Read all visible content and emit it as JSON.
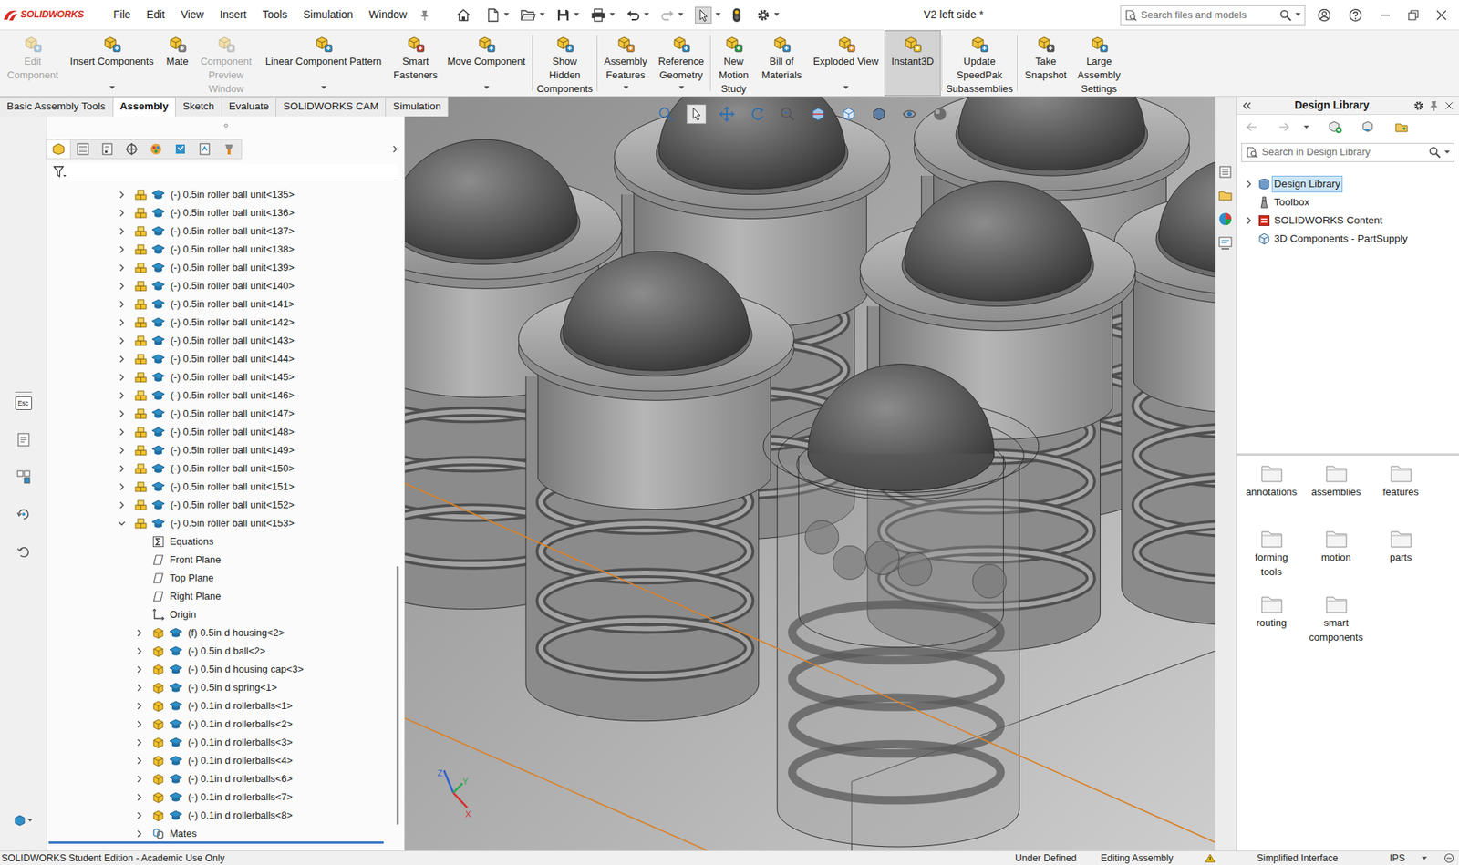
{
  "window": {
    "app_name": "SOLIDWORKS",
    "title": "V2 left side *"
  },
  "menu": [
    "File",
    "Edit",
    "View",
    "Insert",
    "Tools",
    "Simulation",
    "Window"
  ],
  "search": {
    "placeholder": "Search files and models"
  },
  "commands": [
    {
      "label": "Edit Component",
      "disabled": true,
      "selected": false,
      "dropdown": false
    },
    {
      "label": "Insert Components",
      "disabled": false,
      "selected": false,
      "dropdown": true
    },
    {
      "label": "Mate",
      "disabled": false,
      "selected": false,
      "dropdown": false
    },
    {
      "label": "Component Preview Window",
      "disabled": true,
      "selected": false,
      "dropdown": false
    },
    {
      "label": "Linear Component Pattern",
      "disabled": false,
      "selected": false,
      "dropdown": true
    },
    {
      "label": "Smart Fasteners",
      "disabled": false,
      "selected": false,
      "dropdown": false
    },
    {
      "label": "Move Component",
      "disabled": false,
      "selected": false,
      "dropdown": true
    },
    {
      "label": "Show Hidden Components",
      "disabled": false,
      "selected": false,
      "dropdown": false
    },
    {
      "label": "Assembly Features",
      "disabled": false,
      "selected": false,
      "dropdown": true
    },
    {
      "label": "Reference Geometry",
      "disabled": false,
      "selected": false,
      "dropdown": true
    },
    {
      "label": "New Motion Study",
      "disabled": false,
      "selected": false,
      "dropdown": false
    },
    {
      "label": "Bill of Materials",
      "disabled": false,
      "selected": false,
      "dropdown": false
    },
    {
      "label": "Exploded View",
      "disabled": false,
      "selected": false,
      "dropdown": true
    },
    {
      "label": "Instant3D",
      "disabled": false,
      "selected": true,
      "dropdown": false
    },
    {
      "label": "Update SpeedPak Subassemblies",
      "disabled": false,
      "selected": false,
      "dropdown": false
    },
    {
      "label": "Take Snapshot",
      "disabled": false,
      "selected": false,
      "dropdown": false
    },
    {
      "label": "Large Assembly Settings",
      "disabled": false,
      "selected": false,
      "dropdown": false
    }
  ],
  "tabs": [
    {
      "label": "Basic Assembly Tools",
      "selected": false
    },
    {
      "label": "Assembly",
      "selected": true
    },
    {
      "label": "Sketch",
      "selected": false
    },
    {
      "label": "Evaluate",
      "selected": false
    },
    {
      "label": "SOLIDWORKS CAM",
      "selected": false
    },
    {
      "label": "Simulation",
      "selected": false
    }
  ],
  "left_strip": {
    "esc_label": "Esc"
  },
  "viewport": {
    "triad": {
      "x": "X",
      "y": "Y",
      "z": "Z"
    }
  },
  "tree": {
    "rows": [
      {
        "label": "(-) 0.5in roller ball unit<135>",
        "kind": "assembly",
        "depth": 0,
        "expandable": true,
        "expanded": false
      },
      {
        "label": "(-) 0.5in roller ball unit<136>",
        "kind": "assembly",
        "depth": 0,
        "expandable": true,
        "expanded": false
      },
      {
        "label": "(-) 0.5in roller ball unit<137>",
        "kind": "assembly",
        "depth": 0,
        "expandable": true,
        "expanded": false
      },
      {
        "label": "(-) 0.5in roller ball unit<138>",
        "kind": "assembly",
        "depth": 0,
        "expandable": true,
        "expanded": false
      },
      {
        "label": "(-) 0.5in roller ball unit<139>",
        "kind": "assembly",
        "depth": 0,
        "expandable": true,
        "expanded": false
      },
      {
        "label": "(-) 0.5in roller ball unit<140>",
        "kind": "assembly",
        "depth": 0,
        "expandable": true,
        "expanded": false
      },
      {
        "label": "(-) 0.5in roller ball unit<141>",
        "kind": "assembly",
        "depth": 0,
        "expandable": true,
        "expanded": false
      },
      {
        "label": "(-) 0.5in roller ball unit<142>",
        "kind": "assembly",
        "depth": 0,
        "expandable": true,
        "expanded": false
      },
      {
        "label": "(-) 0.5in roller ball unit<143>",
        "kind": "assembly",
        "depth": 0,
        "expandable": true,
        "expanded": false
      },
      {
        "label": "(-) 0.5in roller ball unit<144>",
        "kind": "assembly",
        "depth": 0,
        "expandable": true,
        "expanded": false
      },
      {
        "label": "(-) 0.5in roller ball unit<145>",
        "kind": "assembly",
        "depth": 0,
        "expandable": true,
        "expanded": false
      },
      {
        "label": "(-) 0.5in roller ball unit<146>",
        "kind": "assembly",
        "depth": 0,
        "expandable": true,
        "expanded": false
      },
      {
        "label": "(-) 0.5in roller ball unit<147>",
        "kind": "assembly",
        "depth": 0,
        "expandable": true,
        "expanded": false
      },
      {
        "label": "(-) 0.5in roller ball unit<148>",
        "kind": "assembly",
        "depth": 0,
        "expandable": true,
        "expanded": false
      },
      {
        "label": "(-) 0.5in roller ball unit<149>",
        "kind": "assembly",
        "depth": 0,
        "expandable": true,
        "expanded": false
      },
      {
        "label": "(-) 0.5in roller ball unit<150>",
        "kind": "assembly",
        "depth": 0,
        "expandable": true,
        "expanded": false
      },
      {
        "label": "(-) 0.5in roller ball unit<151>",
        "kind": "assembly",
        "depth": 0,
        "expandable": true,
        "expanded": false
      },
      {
        "label": "(-) 0.5in roller ball unit<152>",
        "kind": "assembly",
        "depth": 0,
        "expandable": true,
        "expanded": false
      },
      {
        "label": "(-) 0.5in roller ball unit<153>",
        "kind": "assembly",
        "depth": 0,
        "expandable": true,
        "expanded": true
      },
      {
        "label": "Equations",
        "kind": "equations",
        "depth": 1,
        "expandable": false,
        "expanded": false
      },
      {
        "label": "Front Plane",
        "kind": "plane",
        "depth": 1,
        "expandable": false,
        "expanded": false
      },
      {
        "label": "Top Plane",
        "kind": "plane",
        "depth": 1,
        "expandable": false,
        "expanded": false
      },
      {
        "label": "Right Plane",
        "kind": "plane",
        "depth": 1,
        "expandable": false,
        "expanded": false
      },
      {
        "label": "Origin",
        "kind": "origin",
        "depth": 1,
        "expandable": false,
        "expanded": false
      },
      {
        "label": "(f) 0.5in d housing<2>",
        "kind": "part",
        "depth": 1,
        "expandable": true,
        "expanded": false
      },
      {
        "label": "(-) 0.5in d ball<2>",
        "kind": "part",
        "depth": 1,
        "expandable": true,
        "expanded": false
      },
      {
        "label": "(-) 0.5in d housing cap<3>",
        "kind": "part",
        "depth": 1,
        "expandable": true,
        "expanded": false
      },
      {
        "label": "(-) 0.5in d spring<1>",
        "kind": "part",
        "depth": 1,
        "expandable": true,
        "expanded": false
      },
      {
        "label": "(-) 0.1in d rollerballs<1>",
        "kind": "part",
        "depth": 1,
        "expandable": true,
        "expanded": false
      },
      {
        "label": "(-) 0.1in d rollerballs<2>",
        "kind": "part",
        "depth": 1,
        "expandable": true,
        "expanded": false
      },
      {
        "label": "(-) 0.1in d rollerballs<3>",
        "kind": "part",
        "depth": 1,
        "expandable": true,
        "expanded": false
      },
      {
        "label": "(-) 0.1in d rollerballs<4>",
        "kind": "part",
        "depth": 1,
        "expandable": true,
        "expanded": false
      },
      {
        "label": "(-) 0.1in d rollerballs<6>",
        "kind": "part",
        "depth": 1,
        "expandable": true,
        "expanded": false
      },
      {
        "label": "(-) 0.1in d rollerballs<7>",
        "kind": "part",
        "depth": 1,
        "expandable": true,
        "expanded": false
      },
      {
        "label": "(-) 0.1in d rollerballs<8>",
        "kind": "part",
        "depth": 1,
        "expandable": true,
        "expanded": false
      },
      {
        "label": "Mates",
        "kind": "mates",
        "depth": 1,
        "expandable": true,
        "expanded": false
      }
    ]
  },
  "design_library": {
    "title": "Design Library",
    "search": {
      "placeholder": "Search in Design Library"
    },
    "items": [
      {
        "label": "Design Library",
        "kind": "library",
        "selected": true,
        "expandable": true
      },
      {
        "label": "Toolbox",
        "kind": "toolbox",
        "selected": false,
        "expandable": false
      },
      {
        "label": "SOLIDWORKS Content",
        "kind": "content",
        "selected": false,
        "expandable": true
      },
      {
        "label": "3D Components - PartSupply",
        "kind": "partsupply",
        "selected": false,
        "expandable": false
      }
    ],
    "folders": [
      "annotations",
      "assemblies",
      "features",
      "forming tools",
      "motion",
      "parts",
      "routing",
      "smart components"
    ]
  },
  "status_bar": {
    "left": "SOLIDWORKS Student Edition - Academic Use Only",
    "items": [
      "Under Defined",
      "Editing Assembly",
      "Simplified Interface",
      "IPS"
    ]
  }
}
